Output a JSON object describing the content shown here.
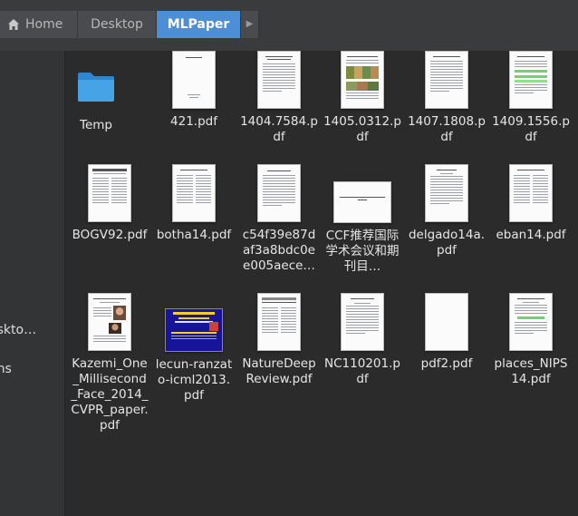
{
  "pathbar": {
    "crumbs": [
      {
        "label": "Home",
        "icon": "home-icon"
      },
      {
        "label": "Desktop"
      },
      {
        "label": "MLPaper",
        "active": true
      }
    ],
    "overflow_icon": "chevron-right-icon"
  },
  "sidebar": {
    "items": [
      "eskto…",
      "ons"
    ]
  },
  "files": [
    {
      "name": "Temp",
      "type": "folder"
    },
    {
      "name": "421.pdf",
      "type": "pdf"
    },
    {
      "name": "1404.7584.pdf",
      "type": "pdf"
    },
    {
      "name": "1405.0312.pdf",
      "type": "pdf"
    },
    {
      "name": "1407.1808.pdf",
      "type": "pdf"
    },
    {
      "name": "1409.1556.pdf",
      "type": "pdf"
    },
    {
      "name": "BOGV92.pdf",
      "type": "pdf"
    },
    {
      "name": "botha14.pdf",
      "type": "pdf"
    },
    {
      "name": "c54f39e87daf3a8bdc0ee005aece…",
      "type": "pdf"
    },
    {
      "name": "CCF推荐国际学术会议和期刊目…",
      "type": "pdf"
    },
    {
      "name": "delgado14a.pdf",
      "type": "pdf"
    },
    {
      "name": "eban14.pdf",
      "type": "pdf"
    },
    {
      "name": "Kazemi_One_Millisecond_Face_2014_CVPR_paper.pdf",
      "type": "pdf"
    },
    {
      "name": "lecun-ranzato-icml2013.pdf",
      "type": "pdf"
    },
    {
      "name": "NatureDeepReview.pdf",
      "type": "pdf"
    },
    {
      "name": "NC110201.pdf",
      "type": "pdf"
    },
    {
      "name": "pdf2.pdf",
      "type": "pdf"
    },
    {
      "name": "places_NIPS14.pdf",
      "type": "pdf"
    }
  ],
  "colors": {
    "accent": "#4c8fd6",
    "background": "#2b2b2b",
    "sidebar": "#333436",
    "folder": "#3d9be0"
  }
}
